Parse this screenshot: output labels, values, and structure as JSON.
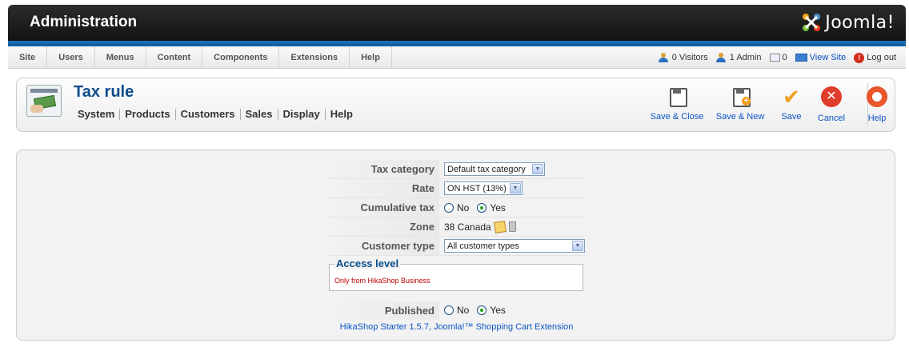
{
  "header": {
    "title": "Administration",
    "logo_text": "Joomla!"
  },
  "menu": [
    "Site",
    "Users",
    "Menus",
    "Content",
    "Components",
    "Extensions",
    "Help"
  ],
  "status": {
    "visitors": "0 Visitors",
    "admins": "1 Admin",
    "messages": "0",
    "view_site": "View Site",
    "logout": "Log out"
  },
  "page": {
    "title": "Tax rule",
    "submenu": [
      "System",
      "Products",
      "Customers",
      "Sales",
      "Display",
      "Help"
    ]
  },
  "toolbar": {
    "save_close": "Save & Close",
    "save_new": "Save & New",
    "save": "Save",
    "cancel": "Cancel",
    "help": "Help"
  },
  "form": {
    "tax_category": {
      "label": "Tax category",
      "value": "Default tax category"
    },
    "rate": {
      "label": "Rate",
      "value": "ON HST (13%)"
    },
    "cumulative": {
      "label": "Cumulative tax",
      "no": "No",
      "yes": "Yes",
      "selected": "Yes"
    },
    "zone": {
      "label": "Zone",
      "value": "38 Canada"
    },
    "customer_type": {
      "label": "Customer type",
      "value": "All customer types"
    },
    "access": {
      "legend": "Access level",
      "message": "Only from HikaShop Business"
    },
    "published": {
      "label": "Published",
      "no": "No",
      "yes": "Yes",
      "selected": "Yes"
    }
  },
  "footer": "HikaShop Starter 1.5.7, Joomla!™ Shopping Cart Extension"
}
